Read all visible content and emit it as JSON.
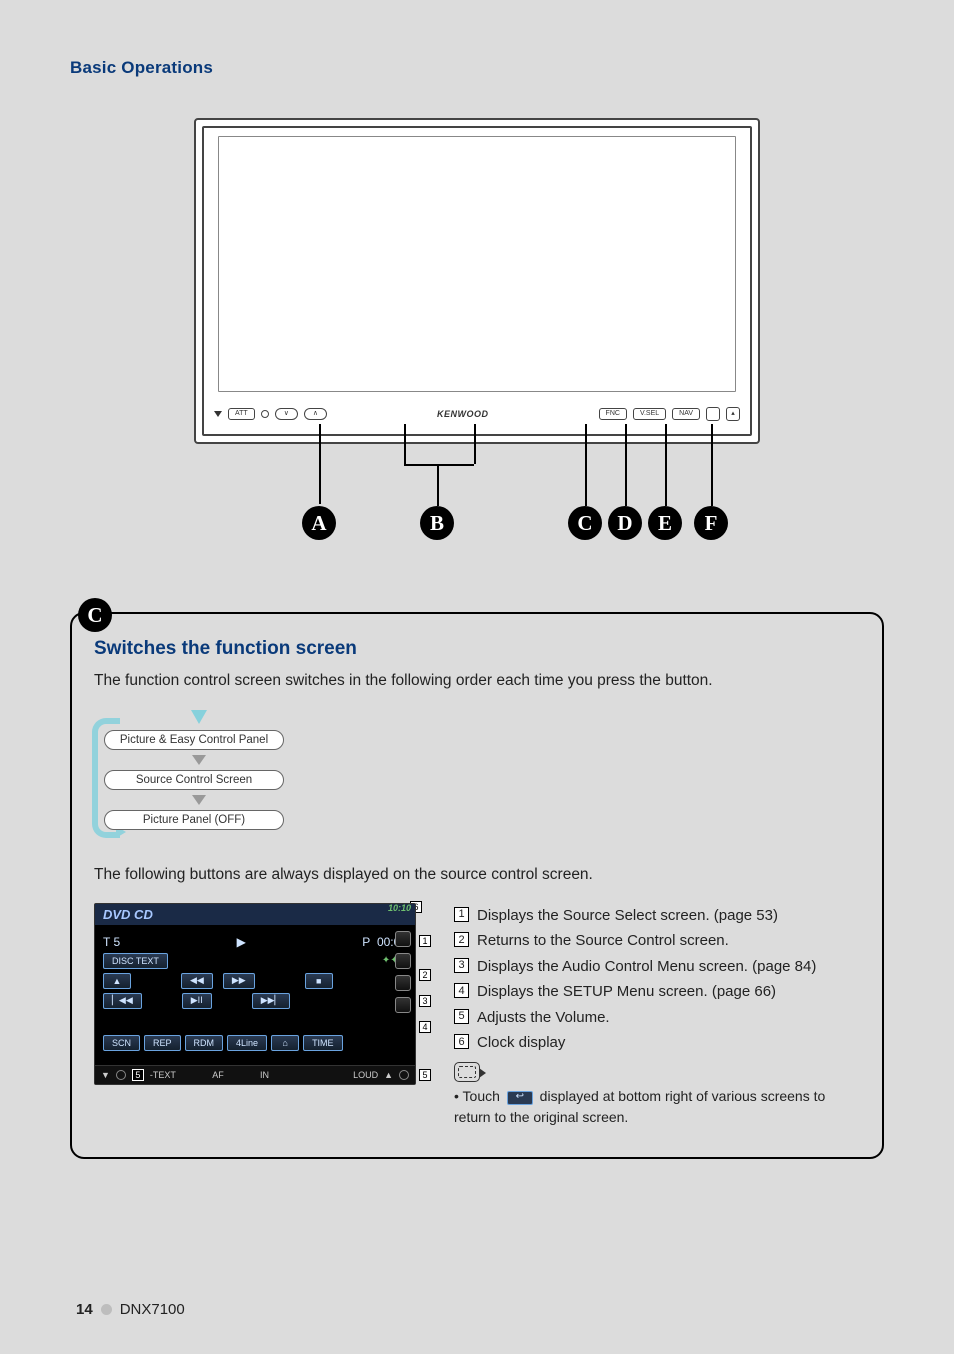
{
  "header": {
    "section_title": "Basic Operations"
  },
  "device": {
    "panel": {
      "brand": "KENWOOD",
      "label_att": "ATT",
      "label_fnc": "FNC",
      "label_vsel": "V.SEL",
      "label_nav": "NAV"
    },
    "pointers": [
      "A",
      "B",
      "C",
      "D",
      "E",
      "F"
    ]
  },
  "box": {
    "badge": "C",
    "title": "Switches the function screen",
    "intro": "The function control screen switches in the following order each time you press the button.",
    "flow": {
      "step1": "Picture & Easy Control Panel",
      "step2": "Source Control Screen",
      "step3": "Picture Panel (OFF)"
    },
    "second_para": "The following buttons are always displayed on the source control screen.",
    "screenshot": {
      "title": "DVD CD",
      "track_label": "T  5",
      "play_glyph": "▶",
      "p_label": "P",
      "time_val": "00:05",
      "disc_text": "DISC TEXT",
      "clock": "10:10",
      "btn_eject": "▲",
      "btn_rew": "◀◀",
      "btn_ff": "▶▶",
      "btn_stop": "■",
      "btn_prev": "▏◀◀",
      "btn_playpause": "▶II",
      "btn_next": "▶▶▏",
      "btn_scn": "SCN",
      "btn_rep": "REP",
      "btn_rdm": "RDM",
      "btn_4line": "4Line",
      "btn_home": "⌂",
      "btn_time": "TIME",
      "foot_text": "-TEXT",
      "foot_af": "AF",
      "foot_in": "IN",
      "foot_loud": "LOUD",
      "ref_1": "1",
      "ref_2": "2",
      "ref_3": "3",
      "ref_4": "4",
      "ref_5": "5",
      "ref_6": "6"
    },
    "list": {
      "i1": {
        "n": "1",
        "t": "Displays the Source Select screen. (page 53)"
      },
      "i2": {
        "n": "2",
        "t": "Returns to the Source Control screen."
      },
      "i3": {
        "n": "3",
        "t": "Displays the Audio Control Menu screen. (page 84)"
      },
      "i4": {
        "n": "4",
        "t": "Displays the SETUP Menu screen. (page 66)"
      },
      "i5": {
        "n": "5",
        "t": "Adjusts the Volume."
      },
      "i6": {
        "n": "6",
        "t": "Clock display"
      }
    },
    "note": {
      "bullet_prefix": "•  Touch ",
      "bullet_suffix": " displayed at bottom right of various screens to return to the original screen.",
      "chip_glyph": "↩"
    }
  },
  "footer": {
    "page_num": "14",
    "model": "DNX7100"
  }
}
